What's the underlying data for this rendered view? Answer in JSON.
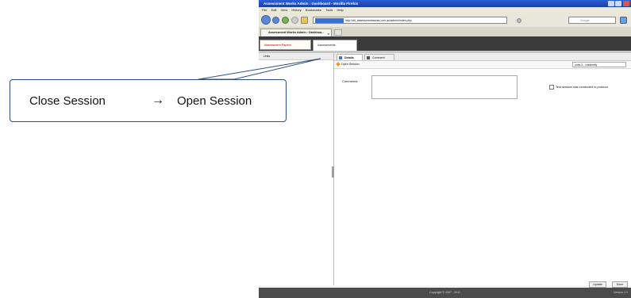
{
  "callout": {
    "from": "Close Session",
    "arrow": "→",
    "to": "Open Session"
  },
  "browser": {
    "title": "Assessment Works Admin : Dashboard - Mozilla Firefox",
    "menu": [
      "File",
      "Edit",
      "View",
      "History",
      "Bookmarks",
      "Tools",
      "Help"
    ],
    "url": "http://dit_assessmentworks.com.au/admin/index.php",
    "search_placeholder": "Google",
    "tab_label": "Assessment Works Admin : Dashboa...",
    "tab_close": "×"
  },
  "app": {
    "tabs": [
      "Assessment Papers",
      "Assessments"
    ],
    "left_header": "Units",
    "inner_tabs": [
      "Details",
      "Comment"
    ],
    "action": "Open Session",
    "select_value": "units-3 - Unidentify",
    "comments_label": "Comments:",
    "checkbox_label": "Test session was conducted to protocol",
    "update_button": "Update",
    "done_button": "Done",
    "footer": "Copyright © 2007 - 2011",
    "version": "Version 1.0"
  }
}
